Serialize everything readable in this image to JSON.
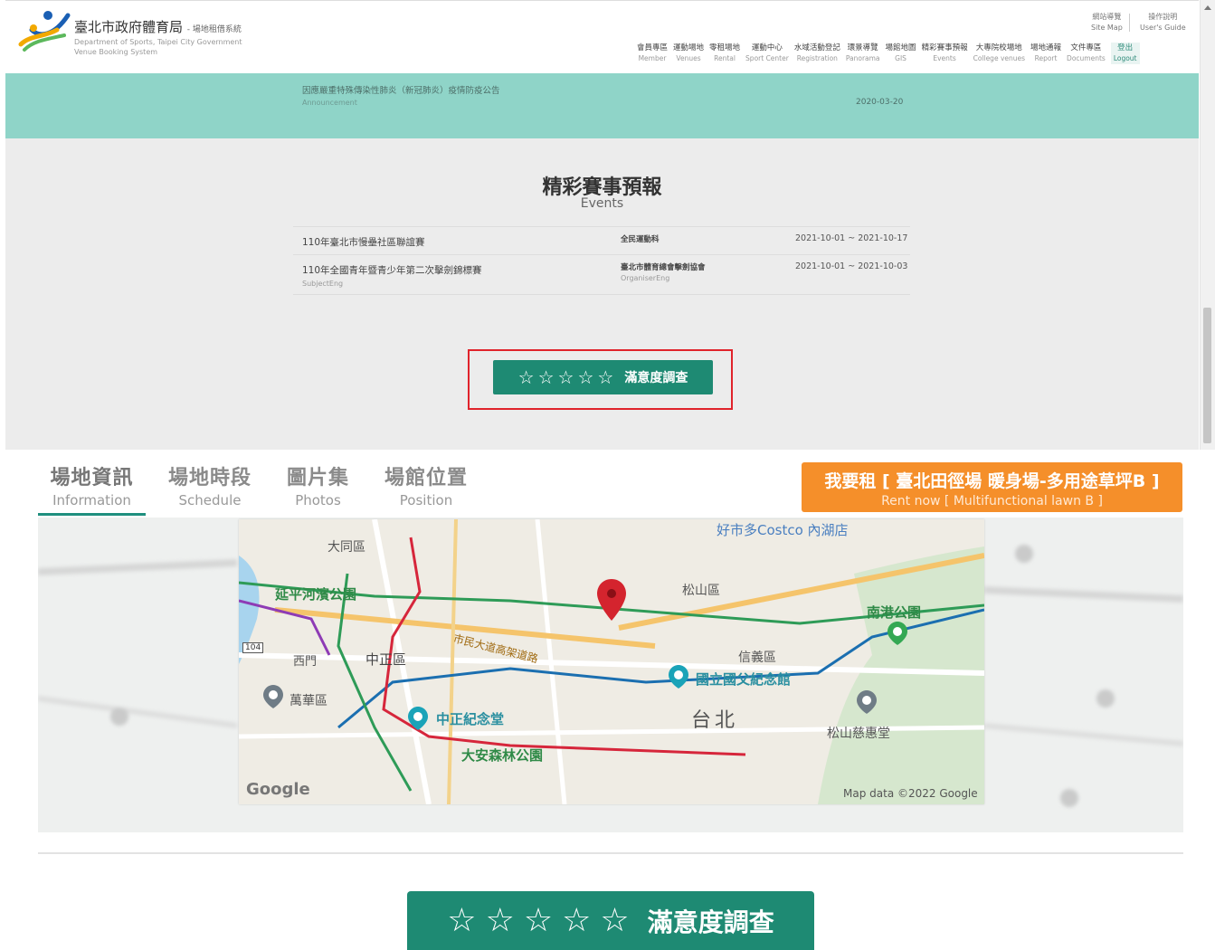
{
  "brand": {
    "title": "臺北市政府體育局",
    "title_suffix": "- 場地租借系統",
    "subtitle_line1": "Department of Sports, Taipei City Government",
    "subtitle_line2": "Venue Booking System"
  },
  "utility": [
    {
      "zh": "網站導覽",
      "en": "Site Map"
    },
    {
      "zh": "操作說明",
      "en": "User's Guide"
    }
  ],
  "nav": [
    {
      "zh": "會員專區",
      "en": "Member"
    },
    {
      "zh": "運動場地",
      "en": "Venues"
    },
    {
      "zh": "零租場地",
      "en": "Rental"
    },
    {
      "zh": "運動中心",
      "en": "Sport Center"
    },
    {
      "zh": "水域活動登記",
      "en": "Registration"
    },
    {
      "zh": "環景導覽",
      "en": "Panorama"
    },
    {
      "zh": "場館地圖",
      "en": "GIS"
    },
    {
      "zh": "精彩賽事預報",
      "en": "Events"
    },
    {
      "zh": "大專院校場地",
      "en": "College venues"
    },
    {
      "zh": "場地通報",
      "en": "Report"
    },
    {
      "zh": "文件專區",
      "en": "Documents"
    },
    {
      "zh": "登出",
      "en": "Logout"
    }
  ],
  "announcement": {
    "title": "因應嚴重特殊傳染性肺炎（新冠肺炎）疫情防疫公告",
    "label": "Announcement",
    "date": "2020-03-20"
  },
  "events": {
    "title": "精彩賽事預報",
    "subtitle": "Events",
    "rows": [
      {
        "subject": "110年臺北市慢壘社區聯誼賽",
        "subject_en": "",
        "organiser": "全民運動科",
        "organiser_en": "",
        "date": "2021-10-01 ~ 2021-10-17"
      },
      {
        "subject": "110年全國青年暨青少年第二次擊劍錦標賽",
        "subject_en": "SubjectEng",
        "organiser": "臺北市體育總會擊劍協會",
        "organiser_en": "OrganiserEng",
        "date": "2021-10-01 ~ 2021-10-03"
      }
    ]
  },
  "survey": {
    "label": "滿意度調查",
    "stars": [
      "☆",
      "☆",
      "☆",
      "☆",
      "☆"
    ]
  },
  "tabs": [
    {
      "zh": "場地資訊",
      "en": "Information"
    },
    {
      "zh": "場地時段",
      "en": "Schedule"
    },
    {
      "zh": "圖片集",
      "en": "Photos"
    },
    {
      "zh": "場館位置",
      "en": "Position"
    }
  ],
  "rent": {
    "zh": "我要租 [ 臺北田徑場 暖身場-多用途草坪B ]",
    "en": "Rent now [ Multifunctional lawn B ]"
  },
  "map": {
    "labels": {
      "costco": "好市多Costco 內湖店",
      "datong": "大同區",
      "songshan": "松山區",
      "park": "延平河濱公園",
      "nangang": "南港公園",
      "zhongzheng": "中正區",
      "ximen": "西門",
      "xinyi": "信義區",
      "sunyatsen": "國立國父紀念館",
      "wanhua": "萬華區",
      "cks": "中正紀念堂",
      "taipei": "台北",
      "daan": "大安森林公園",
      "ciyou": "松山慈惠堂",
      "expressway": "市民大道高架道路",
      "route": "104",
      "attribution": "Map data ©2022 Google",
      "google": "Google"
    }
  }
}
